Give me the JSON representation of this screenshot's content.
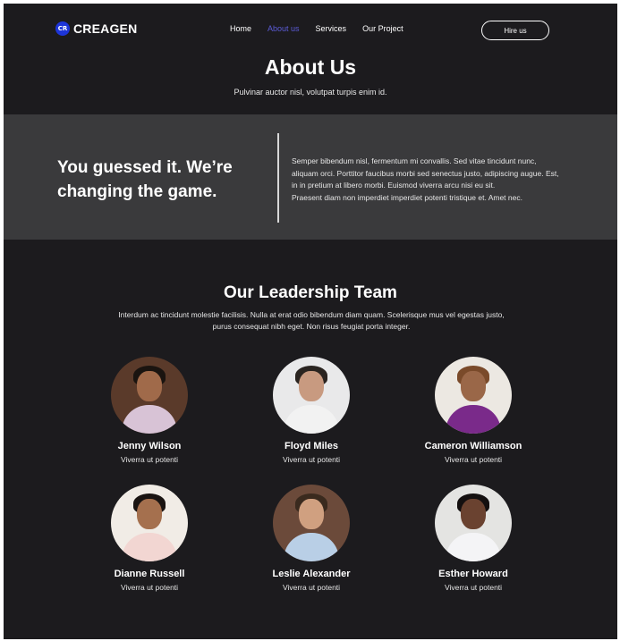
{
  "brand": {
    "mark": "CR",
    "name": "CREAGEN",
    "accent": "#1d35d8"
  },
  "nav": {
    "items": [
      {
        "label": "Home",
        "active": false
      },
      {
        "label": "About us",
        "active": true
      },
      {
        "label": "Services",
        "active": false
      },
      {
        "label": "Our Project",
        "active": false
      }
    ],
    "active_color": "#5b5bd6",
    "cta": "Hire us"
  },
  "hero": {
    "title": "About Us",
    "subtitle": "Pulvinar auctor nisl, volutpat turpis enim id."
  },
  "band": {
    "heading": "You guessed it. We’re changing the game.",
    "paragraph1": "Semper bibendum nisl, fermentum mi convallis. Sed vitae tincidunt nunc, aliquam orci. Porttitor faucibus morbi sed senectus justo, adipiscing augue. Est, in in pretium at libero morbi. Euismod viverra arcu nisi eu sit.",
    "paragraph2": "Praesent diam non imperdiet imperdiet potenti tristique et. Amet nec."
  },
  "team": {
    "title": "Our Leadership Team",
    "subtitle": "Interdum ac tincidunt molestie facilisis. Nulla at erat odio bibendum diam quam. Scelerisque mus vel egestas justo, purus consequat nibh eget. Non risus feugiat porta integer.",
    "members": [
      {
        "name": "Jenny Wilson",
        "role": "Viverra ut potenti",
        "bg": "#5a3a2a",
        "skin": "#a06a4a",
        "hair": "#1a1410",
        "shirt": "#d8c3d6"
      },
      {
        "name": "Floyd Miles",
        "role": "Viverra ut potenti",
        "bg": "#e9e9ea",
        "skin": "#c89a80",
        "hair": "#2a2420",
        "shirt": "#f2f2f2"
      },
      {
        "name": "Cameron Williamson",
        "role": "Viverra ut potenti",
        "bg": "#ece8e2",
        "skin": "#9a6748",
        "hair": "#7a4a2a",
        "shirt": "#7a2a8a"
      },
      {
        "name": "Dianne Russell",
        "role": "Viverra ut potenti",
        "bg": "#f1ece6",
        "skin": "#a5704e",
        "hair": "#1a1412",
        "shirt": "#f2d6d2"
      },
      {
        "name": "Leslie Alexander",
        "role": "Viverra ut potenti",
        "bg": "#6b4a3a",
        "skin": "#d0a080",
        "hair": "#3a2a1e",
        "shirt": "#b9cfe6"
      },
      {
        "name": "Esther Howard",
        "role": "Viverra ut potenti",
        "bg": "#e4e4e2",
        "skin": "#6a4230",
        "hair": "#141010",
        "shirt": "#f4f4f6"
      }
    ]
  }
}
